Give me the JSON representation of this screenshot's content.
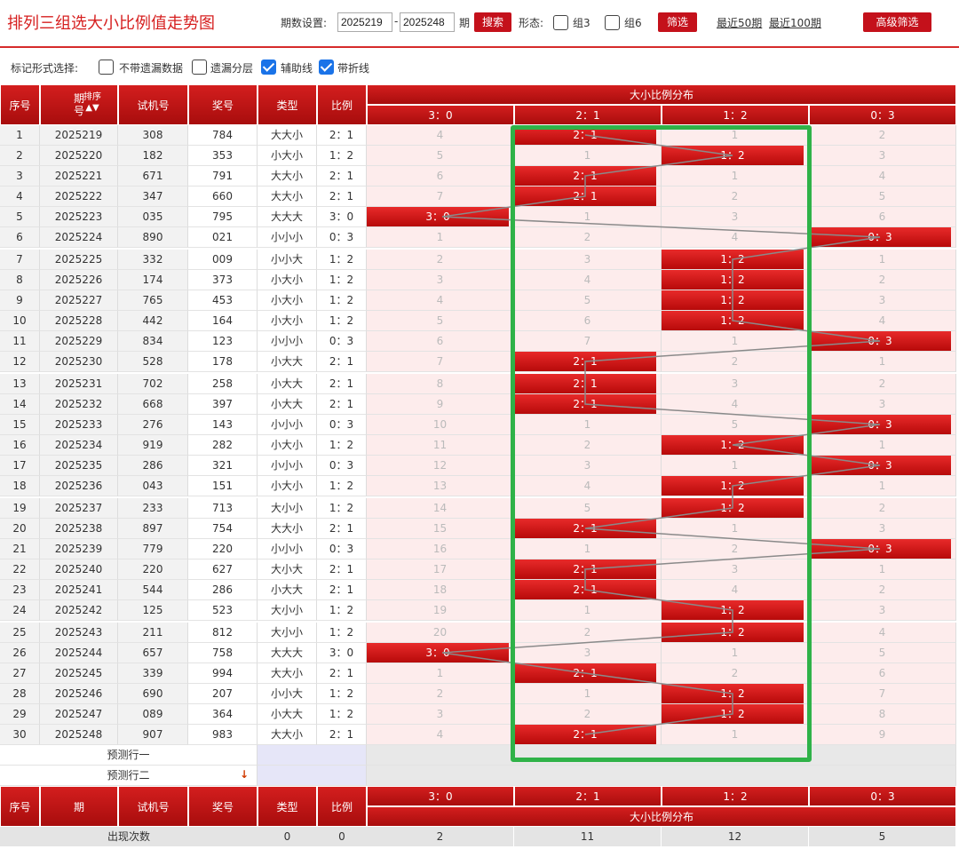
{
  "header": {
    "title": "排列三组选大小比例值走势图",
    "period_label": "期数设置:",
    "period_from": "2025219",
    "period_dash": "-",
    "period_to": "2025248",
    "period_unit": "期",
    "search_btn": "搜索",
    "form_label": "形态:",
    "opt_zu3": "组3",
    "opt_zu6": "组6",
    "filter_btn": "筛选",
    "link_50": "最近50期",
    "link_100": "最近100期",
    "advanced_btn": "高级筛选"
  },
  "options": {
    "label": "标记形式选择:",
    "o1": "不带遗漏数据",
    "o2": "遗漏分层",
    "o3": "辅助线",
    "o4": "带折线"
  },
  "table": {
    "h_seq": "序号",
    "h_issue_a": "期",
    "h_issue_b": "号",
    "h_sort": "排序",
    "h_trial": "试机号",
    "h_prize": "奖号",
    "h_type": "类型",
    "h_ratio": "比例",
    "h_dist": "大小比例分布",
    "ratios": [
      "3：0",
      "2：1",
      "1：2",
      "0：3"
    ],
    "rows": [
      [
        "1",
        "2025219",
        "308",
        "784",
        "大大小",
        "2：1",
        [
          4,
          "H",
          1,
          2
        ]
      ],
      [
        "2",
        "2025220",
        "182",
        "353",
        "小大小",
        "1：2",
        [
          5,
          1,
          "H",
          3
        ]
      ],
      [
        "3",
        "2025221",
        "671",
        "791",
        "大大小",
        "2：1",
        [
          6,
          "H",
          1,
          4
        ]
      ],
      [
        "4",
        "2025222",
        "347",
        "660",
        "大大小",
        "2：1",
        [
          7,
          "H",
          2,
          5
        ]
      ],
      [
        "5",
        "2025223",
        "035",
        "795",
        "大大大",
        "3：0",
        [
          "H",
          1,
          3,
          6
        ]
      ],
      [
        "6",
        "2025224",
        "890",
        "021",
        "小小小",
        "0：3",
        [
          1,
          2,
          4,
          "H"
        ]
      ],
      [
        "7",
        "2025225",
        "332",
        "009",
        "小小大",
        "1：2",
        [
          2,
          3,
          "H",
          1
        ]
      ],
      [
        "8",
        "2025226",
        "174",
        "373",
        "小大小",
        "1：2",
        [
          3,
          4,
          "H",
          2
        ]
      ],
      [
        "9",
        "2025227",
        "765",
        "453",
        "小大小",
        "1：2",
        [
          4,
          5,
          "H",
          3
        ]
      ],
      [
        "10",
        "2025228",
        "442",
        "164",
        "小大小",
        "1：2",
        [
          5,
          6,
          "H",
          4
        ]
      ],
      [
        "11",
        "2025229",
        "834",
        "123",
        "小小小",
        "0：3",
        [
          6,
          7,
          1,
          "H"
        ]
      ],
      [
        "12",
        "2025230",
        "528",
        "178",
        "小大大",
        "2：1",
        [
          7,
          "H",
          2,
          1
        ]
      ],
      [
        "13",
        "2025231",
        "702",
        "258",
        "小大大",
        "2：1",
        [
          8,
          "H",
          3,
          2
        ]
      ],
      [
        "14",
        "2025232",
        "668",
        "397",
        "小大大",
        "2：1",
        [
          9,
          "H",
          4,
          3
        ]
      ],
      [
        "15",
        "2025233",
        "276",
        "143",
        "小小小",
        "0：3",
        [
          10,
          1,
          5,
          "H"
        ]
      ],
      [
        "16",
        "2025234",
        "919",
        "282",
        "小大小",
        "1：2",
        [
          11,
          2,
          "H",
          1
        ]
      ],
      [
        "17",
        "2025235",
        "286",
        "321",
        "小小小",
        "0：3",
        [
          12,
          3,
          1,
          "H"
        ]
      ],
      [
        "18",
        "2025236",
        "043",
        "151",
        "小大小",
        "1：2",
        [
          13,
          4,
          "H",
          1
        ]
      ],
      [
        "19",
        "2025237",
        "233",
        "713",
        "大小小",
        "1：2",
        [
          14,
          5,
          "H",
          2
        ]
      ],
      [
        "20",
        "2025238",
        "897",
        "754",
        "大大小",
        "2：1",
        [
          15,
          "H",
          1,
          3
        ]
      ],
      [
        "21",
        "2025239",
        "779",
        "220",
        "小小小",
        "0：3",
        [
          16,
          1,
          2,
          "H"
        ]
      ],
      [
        "22",
        "2025240",
        "220",
        "627",
        "大小大",
        "2：1",
        [
          17,
          "H",
          3,
          1
        ]
      ],
      [
        "23",
        "2025241",
        "544",
        "286",
        "小大大",
        "2：1",
        [
          18,
          "H",
          4,
          2
        ]
      ],
      [
        "24",
        "2025242",
        "125",
        "523",
        "大小小",
        "1：2",
        [
          19,
          1,
          "H",
          3
        ]
      ],
      [
        "25",
        "2025243",
        "211",
        "812",
        "大小小",
        "1：2",
        [
          20,
          2,
          "H",
          4
        ]
      ],
      [
        "26",
        "2025244",
        "657",
        "758",
        "大大大",
        "3：0",
        [
          "H",
          3,
          1,
          5
        ]
      ],
      [
        "27",
        "2025245",
        "339",
        "994",
        "大大小",
        "2：1",
        [
          1,
          "H",
          2,
          6
        ]
      ],
      [
        "28",
        "2025246",
        "690",
        "207",
        "小小大",
        "1：2",
        [
          2,
          1,
          "H",
          7
        ]
      ],
      [
        "29",
        "2025247",
        "089",
        "364",
        "小大大",
        "1：2",
        [
          3,
          2,
          "H",
          8
        ]
      ],
      [
        "30",
        "2025248",
        "907",
        "983",
        "大大小",
        "2：1",
        [
          4,
          "H",
          1,
          9
        ]
      ]
    ],
    "predict1": "预测行一",
    "predict2": "预测行二",
    "foot_label": "出现次数",
    "foot_type": "0",
    "foot_ratio": "0",
    "foot_counts": [
      "2",
      "11",
      "12",
      "5"
    ]
  },
  "colors": {
    "red": "#c4111b",
    "pink": "#fdecec",
    "highlight_border": "#2fb248"
  },
  "icons": {
    "sort": "sort-arrows-icon",
    "down": "arrow-down-icon"
  }
}
